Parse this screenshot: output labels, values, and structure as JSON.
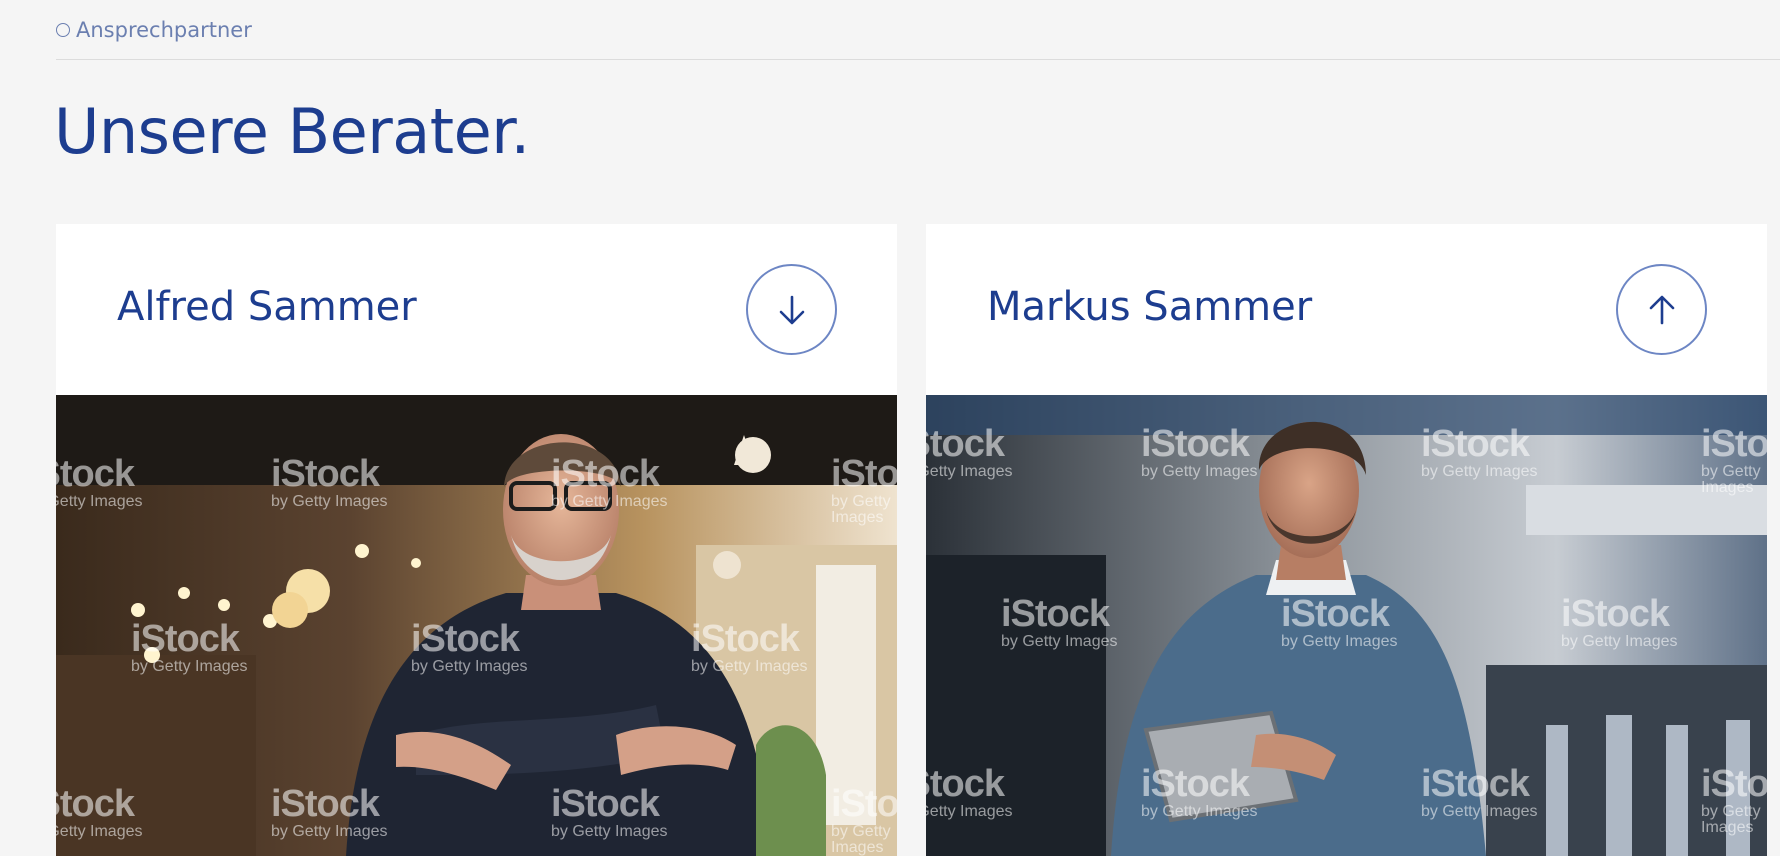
{
  "breadcrumb": {
    "label": "Ansprechpartner"
  },
  "page": {
    "title": "Unsere Berater."
  },
  "advisors": [
    {
      "name": "Alfred Sammer",
      "toggle_icon": "arrow-down-icon"
    },
    {
      "name": "Markus Sammer",
      "toggle_icon": "arrow-up-icon"
    }
  ],
  "watermark": {
    "brand": "iStock",
    "sub": "by Getty Images"
  },
  "colors": {
    "accent": "#1d3d8f",
    "button_border": "#6d86c4",
    "background": "#f5f5f5"
  }
}
